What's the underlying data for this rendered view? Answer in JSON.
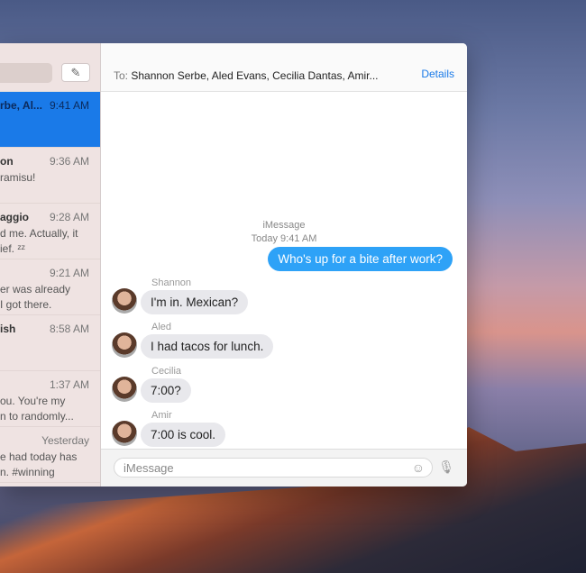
{
  "sidebar": {
    "conversations": [
      {
        "name": "rbe, Al...",
        "time": "9:41 AM",
        "preview": "",
        "selected": true
      },
      {
        "name": "on",
        "time": "9:36 AM",
        "preview": "ramisu!"
      },
      {
        "name": "aggio",
        "time": "9:28 AM",
        "preview": "d me. Actually, it\nief. ᶻᶻ"
      },
      {
        "name": "",
        "time": "9:21 AM",
        "preview": "er was already\nI got there."
      },
      {
        "name": "ish",
        "time": "8:58 AM",
        "preview": ""
      },
      {
        "name": "",
        "time": "1:37 AM",
        "preview": "ou. You're my\nn to randomly..."
      },
      {
        "name": "",
        "time": "Yesterday",
        "preview": "e had today has\nn. #winning"
      }
    ]
  },
  "header": {
    "to_label": "To:",
    "recipients": "Shannon Serbe, Aled Evans, Cecilia Dantas, Amir...",
    "details": "Details"
  },
  "conversation": {
    "service": "iMessage",
    "timestamp": "Today 9:41 AM",
    "outgoing": "Who's up for a bite after work?",
    "incoming": [
      {
        "sender": "Shannon",
        "text": "I'm in. Mexican?"
      },
      {
        "sender": "Aled",
        "text": "I had tacos for lunch."
      },
      {
        "sender": "Cecilia",
        "text": "7:00?"
      },
      {
        "sender": "Amir",
        "text": "7:00 is cool."
      }
    ]
  },
  "composer": {
    "placeholder": "iMessage"
  },
  "colors": {
    "accent": "#1a7ae8",
    "outgoing_bubble": "#2ea2f7"
  }
}
